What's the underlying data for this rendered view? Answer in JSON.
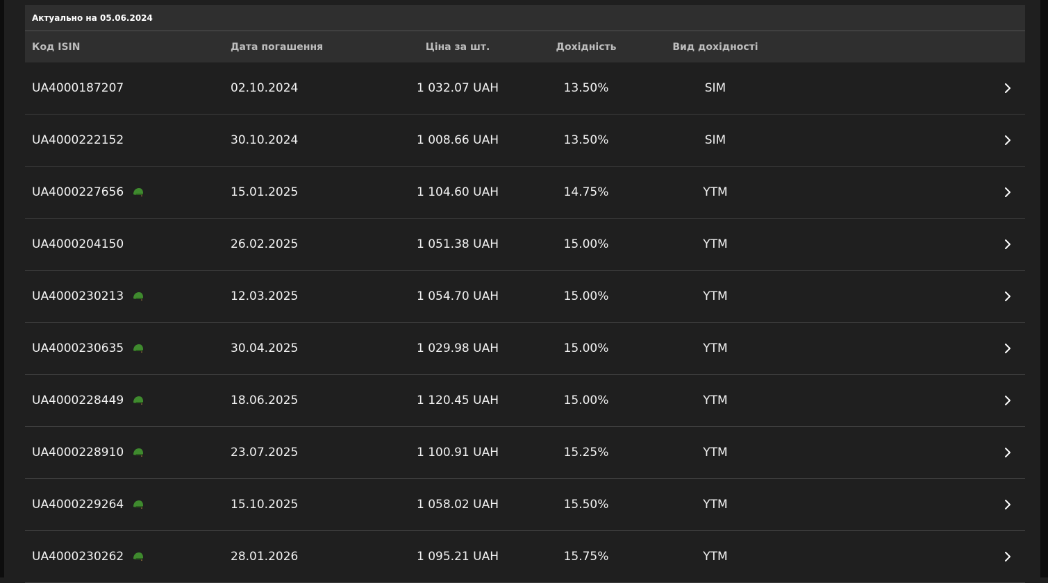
{
  "table": {
    "updated_label": "Актуально на 05.06.2024",
    "headers": {
      "isin": "Код ISIN",
      "maturity": "Дата погашення",
      "price": "Ціна за шт.",
      "yield": "Дохідність",
      "yield_type": "Вид дохідності"
    },
    "rows": [
      {
        "isin": "UA4000187207",
        "military": false,
        "maturity": "02.10.2024",
        "price": "1 032.07 UAH",
        "yield": "13.50%",
        "yield_type": "SIM"
      },
      {
        "isin": "UA4000222152",
        "military": false,
        "maturity": "30.10.2024",
        "price": "1 008.66 UAH",
        "yield": "13.50%",
        "yield_type": "SIM"
      },
      {
        "isin": "UA4000227656",
        "military": true,
        "maturity": "15.01.2025",
        "price": "1 104.60 UAH",
        "yield": "14.75%",
        "yield_type": "YTM"
      },
      {
        "isin": "UA4000204150",
        "military": false,
        "maturity": "26.02.2025",
        "price": "1 051.38 UAH",
        "yield": "15.00%",
        "yield_type": "YTM"
      },
      {
        "isin": "UA4000230213",
        "military": true,
        "maturity": "12.03.2025",
        "price": "1 054.70 UAH",
        "yield": "15.00%",
        "yield_type": "YTM"
      },
      {
        "isin": "UA4000230635",
        "military": true,
        "maturity": "30.04.2025",
        "price": "1 029.98 UAH",
        "yield": "15.00%",
        "yield_type": "YTM"
      },
      {
        "isin": "UA4000228449",
        "military": true,
        "maturity": "18.06.2025",
        "price": "1 120.45 UAH",
        "yield": "15.00%",
        "yield_type": "YTM"
      },
      {
        "isin": "UA4000228910",
        "military": true,
        "maturity": "23.07.2025",
        "price": "1 100.91 UAH",
        "yield": "15.25%",
        "yield_type": "YTM"
      },
      {
        "isin": "UA4000229264",
        "military": true,
        "maturity": "15.10.2025",
        "price": "1 058.02 UAH",
        "yield": "15.50%",
        "yield_type": "YTM"
      },
      {
        "isin": "UA4000230262",
        "military": true,
        "maturity": "28.01.2026",
        "price": "1 095.21 UAH",
        "yield": "15.75%",
        "yield_type": "YTM"
      }
    ]
  },
  "icons": {
    "military": "helmet-icon",
    "row_action": "chevron-right-icon"
  },
  "colors": {
    "background": "#1f1f1f",
    "header_background": "#2f2f2f",
    "helmet_green": "#3f8a2e"
  }
}
